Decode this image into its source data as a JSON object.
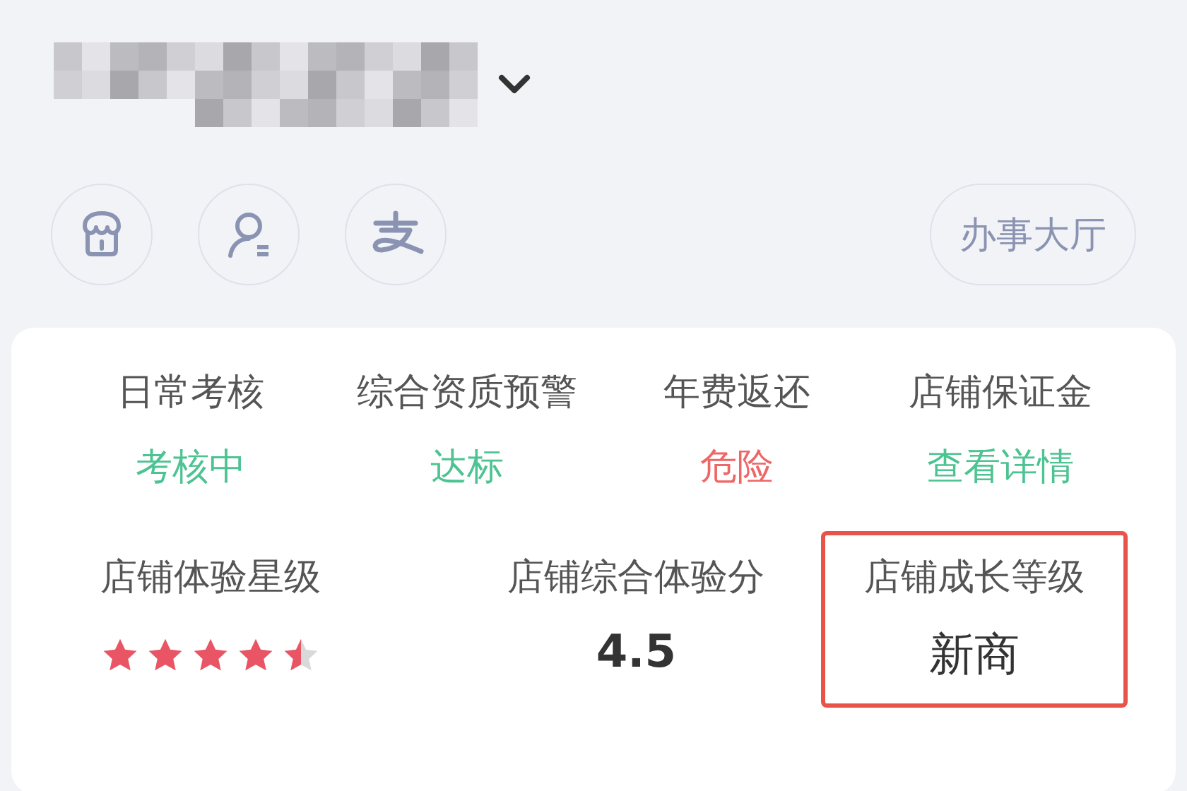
{
  "store": {
    "name_redacted": true,
    "dropdown": true
  },
  "shortcuts": [
    {
      "kind": "store"
    },
    {
      "kind": "user"
    },
    {
      "kind": "pay"
    }
  ],
  "hall_button": {
    "label": "办事大厅"
  },
  "metrics": [
    {
      "label": "日常考核",
      "value": "考核中",
      "color": "#4cc391"
    },
    {
      "label": "综合资质预警",
      "value": "达标",
      "color": "#4cc391"
    },
    {
      "label": "年费返还",
      "value": "危险",
      "color": "#ee6666"
    },
    {
      "label": "店铺保证金",
      "value": "查看详情",
      "color": "#4cc391"
    }
  ],
  "ratings": [
    {
      "kind": "stars",
      "label": "店铺体验星级",
      "stars": 4.5,
      "highlighted": false
    },
    {
      "kind": "score",
      "label": "店铺综合体验分",
      "value": "4.5",
      "highlighted": false
    },
    {
      "kind": "level",
      "label": "店铺成长等级",
      "value": "新商",
      "highlighted": true
    }
  ]
}
